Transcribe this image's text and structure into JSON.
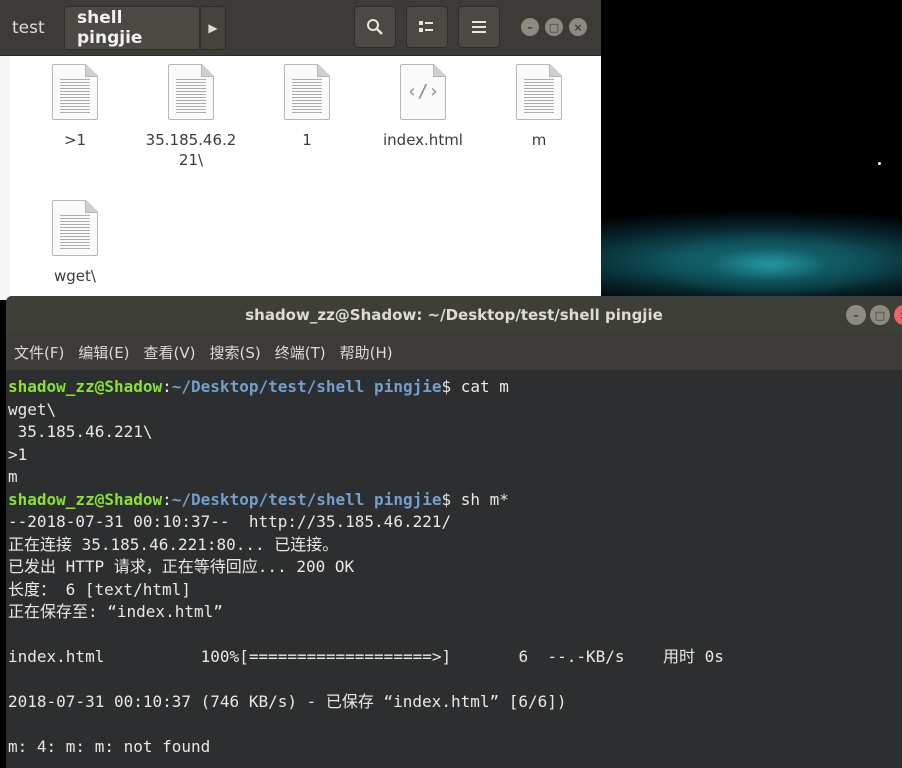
{
  "file_manager": {
    "tabs": [
      "test",
      "shell pingjie"
    ],
    "active_tab": "shell pingjie",
    "buttons": {
      "search": "search-icon",
      "view": "grid-view-icon",
      "menu": "hamburger-menu-icon"
    },
    "files": [
      {
        "name": ">1",
        "type": "text"
      },
      {
        "name": "35.185.46.221\\",
        "type": "text"
      },
      {
        "name": "1",
        "type": "text"
      },
      {
        "name": "index.html",
        "type": "html"
      },
      {
        "name": "m",
        "type": "text"
      },
      {
        "name": "wget\\",
        "type": "text"
      }
    ]
  },
  "terminal": {
    "title": "shadow_zz@Shadow: ~/Desktop/test/shell pingjie",
    "menu": [
      "文件(F)",
      "编辑(E)",
      "查看(V)",
      "搜索(S)",
      "终端(T)",
      "帮助(H)"
    ],
    "prompt_user": "shadow_zz@Shadow",
    "prompt_path": "~/Desktop/test/shell pingjie",
    "lines": [
      {
        "kind": "prompt",
        "cmd": "cat m"
      },
      {
        "kind": "out",
        "text": "wget\\"
      },
      {
        "kind": "out",
        "text": " 35.185.46.221\\"
      },
      {
        "kind": "out",
        "text": ">1"
      },
      {
        "kind": "out",
        "text": "m"
      },
      {
        "kind": "prompt",
        "cmd": "sh m*"
      },
      {
        "kind": "out",
        "text": "--2018-07-31 00:10:37--  http://35.185.46.221/"
      },
      {
        "kind": "out",
        "text": "正在连接 35.185.46.221:80... 已连接。"
      },
      {
        "kind": "out",
        "text": "已发出 HTTP 请求，正在等待回应... 200 OK"
      },
      {
        "kind": "out",
        "text": "长度： 6 [text/html]"
      },
      {
        "kind": "out",
        "text": "正在保存至: “index.html”"
      },
      {
        "kind": "out",
        "text": ""
      },
      {
        "kind": "out",
        "text": "index.html          100%[===================>]       6  --.-KB/s    用时 0s"
      },
      {
        "kind": "out",
        "text": ""
      },
      {
        "kind": "out",
        "text": "2018-07-31 00:10:37 (746 KB/s) - 已保存 “index.html” [6/6])"
      },
      {
        "kind": "out",
        "text": ""
      },
      {
        "kind": "out",
        "text": "m: 4: m: m: not found"
      }
    ]
  },
  "colors": {
    "prompt_user": "#8ae234",
    "prompt_path": "#729fcf",
    "terminal_bg": "#2c2e2f",
    "titlebar": "#3f3f3a"
  }
}
